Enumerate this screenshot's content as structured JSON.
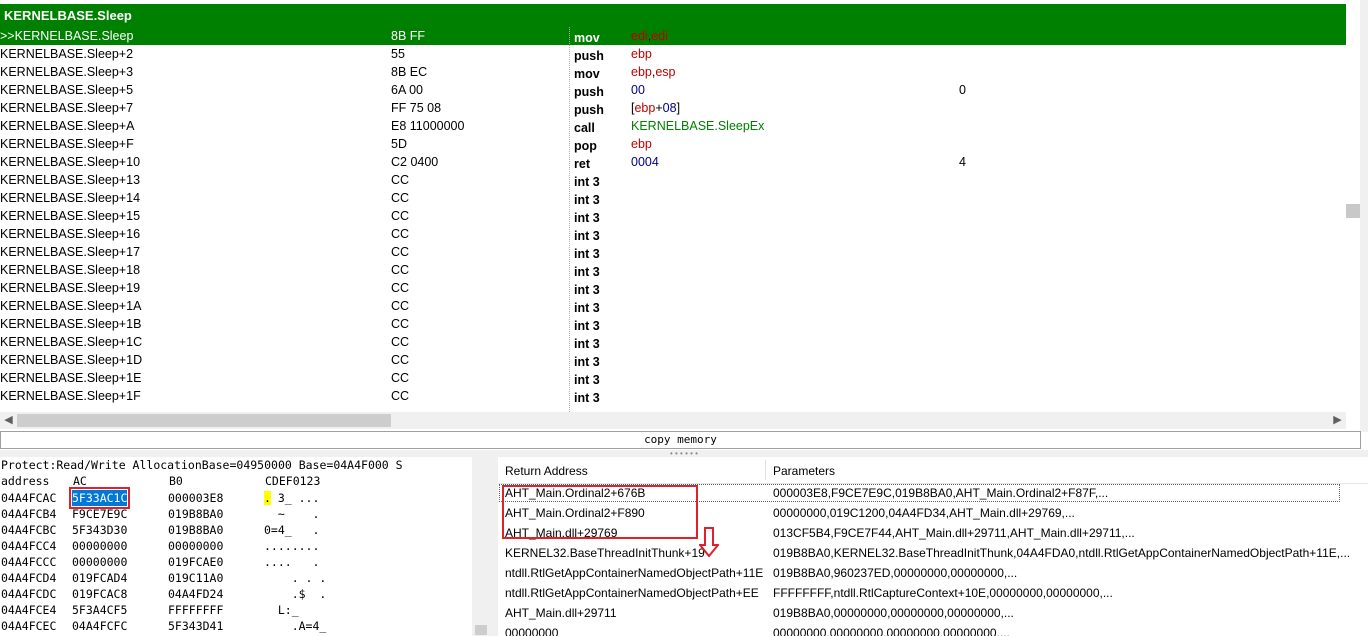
{
  "disasm": {
    "title": "KERNELBASE.Sleep",
    "rows": [
      {
        "addr": ">>KERNELBASE.Sleep",
        "bytes": "8B FF",
        "mn": "mov",
        "ops": [
          {
            "t": "edi",
            "c": "reg"
          },
          {
            "t": ",",
            "c": "plain"
          },
          {
            "t": "edi",
            "c": "reg"
          }
        ],
        "cm": "",
        "current": true
      },
      {
        "addr": "KERNELBASE.Sleep+2",
        "bytes": "55",
        "mn": "push",
        "ops": [
          {
            "t": "ebp",
            "c": "reg"
          }
        ],
        "cm": ""
      },
      {
        "addr": "KERNELBASE.Sleep+3",
        "bytes": "8B EC",
        "mn": "mov",
        "ops": [
          {
            "t": "ebp",
            "c": "reg"
          },
          {
            "t": ",",
            "c": "plain"
          },
          {
            "t": "esp",
            "c": "reg"
          }
        ],
        "cm": ""
      },
      {
        "addr": "KERNELBASE.Sleep+5",
        "bytes": "6A 00",
        "mn": "push",
        "ops": [
          {
            "t": "00",
            "c": "num"
          }
        ],
        "cm": "0"
      },
      {
        "addr": "KERNELBASE.Sleep+7",
        "bytes": "FF 75 08",
        "mn": "push",
        "ops": [
          {
            "t": "[",
            "c": "plain"
          },
          {
            "t": "ebp",
            "c": "reg"
          },
          {
            "t": "+",
            "c": "plain"
          },
          {
            "t": "08",
            "c": "num"
          },
          {
            "t": "]",
            "c": "plain"
          }
        ],
        "cm": ""
      },
      {
        "addr": "KERNELBASE.Sleep+A",
        "bytes": "E8 11000000",
        "mn": "call",
        "ops": [
          {
            "t": "KERNELBASE.SleepEx",
            "c": "call"
          }
        ],
        "cm": ""
      },
      {
        "addr": "KERNELBASE.Sleep+F",
        "bytes": "5D",
        "mn": "pop",
        "ops": [
          {
            "t": "ebp",
            "c": "reg"
          }
        ],
        "cm": ""
      },
      {
        "addr": "KERNELBASE.Sleep+10",
        "bytes": "C2 0400",
        "mn": "ret",
        "ops": [
          {
            "t": "0004",
            "c": "num"
          }
        ],
        "cm": "4"
      },
      {
        "addr": "KERNELBASE.Sleep+13",
        "bytes": "CC",
        "mn": "int 3",
        "ops": [],
        "cm": ""
      },
      {
        "addr": "KERNELBASE.Sleep+14",
        "bytes": "CC",
        "mn": "int 3",
        "ops": [],
        "cm": ""
      },
      {
        "addr": "KERNELBASE.Sleep+15",
        "bytes": "CC",
        "mn": "int 3",
        "ops": [],
        "cm": ""
      },
      {
        "addr": "KERNELBASE.Sleep+16",
        "bytes": "CC",
        "mn": "int 3",
        "ops": [],
        "cm": ""
      },
      {
        "addr": "KERNELBASE.Sleep+17",
        "bytes": "CC",
        "mn": "int 3",
        "ops": [],
        "cm": ""
      },
      {
        "addr": "KERNELBASE.Sleep+18",
        "bytes": "CC",
        "mn": "int 3",
        "ops": [],
        "cm": ""
      },
      {
        "addr": "KERNELBASE.Sleep+19",
        "bytes": "CC",
        "mn": "int 3",
        "ops": [],
        "cm": ""
      },
      {
        "addr": "KERNELBASE.Sleep+1A",
        "bytes": "CC",
        "mn": "int 3",
        "ops": [],
        "cm": ""
      },
      {
        "addr": "KERNELBASE.Sleep+1B",
        "bytes": "CC",
        "mn": "int 3",
        "ops": [],
        "cm": ""
      },
      {
        "addr": "KERNELBASE.Sleep+1C",
        "bytes": "CC",
        "mn": "int 3",
        "ops": [],
        "cm": ""
      },
      {
        "addr": "KERNELBASE.Sleep+1D",
        "bytes": "CC",
        "mn": "int 3",
        "ops": [],
        "cm": ""
      },
      {
        "addr": "KERNELBASE.Sleep+1E",
        "bytes": "CC",
        "mn": "int 3",
        "ops": [],
        "cm": ""
      },
      {
        "addr": "KERNELBASE.Sleep+1F",
        "bytes": "CC",
        "mn": "int 3",
        "ops": [],
        "cm": ""
      }
    ]
  },
  "copybar": {
    "label": "copy memory"
  },
  "dump": {
    "info": "Protect:Read/Write  AllocationBase=04950000 Base=04A4F000 S",
    "cols": {
      "address": "address",
      "c1": "AC",
      "c2": "B0",
      "c3": "CDEF0123"
    },
    "rows": [
      {
        "addr": "04A4FCAC",
        "v1": "5F33AC1C",
        "v2": "000003E8",
        "asc_hl": ".",
        "asc": " 3_ ...",
        "selected": true
      },
      {
        "addr": "04A4FCB4",
        "v1": "F9CE7E9C",
        "v2": "019B8BA0",
        "asc": "  ~    ."
      },
      {
        "addr": "04A4FCBC",
        "v1": "5F343D30",
        "v2": "019B8BA0",
        "asc": "0=4_   ."
      },
      {
        "addr": "04A4FCC4",
        "v1": "00000000",
        "v2": "00000000",
        "asc": "........"
      },
      {
        "addr": "04A4FCCC",
        "v1": "00000000",
        "v2": "019FCAE0",
        "asc": "....   ."
      },
      {
        "addr": "04A4FCD4",
        "v1": "019FCAD4",
        "v2": "019C11A0",
        "asc": "    . . ."
      },
      {
        "addr": "04A4FCDC",
        "v1": "019FCAC8",
        "v2": "04A4FD24",
        "asc": "    .$  ."
      },
      {
        "addr": "04A4FCE4",
        "v1": "5F3A4CF5",
        "v2": "FFFFFFFF",
        "asc": "  L:_"
      },
      {
        "addr": "04A4FCEC",
        "v1": "04A4FCFC",
        "v2": "5F343D41",
        "asc": "    .A=4_"
      }
    ]
  },
  "stack": {
    "headers": {
      "ret": "Return Address",
      "par": "Parameters"
    },
    "rows": [
      {
        "ret": "AHT_Main.Ordinal2+676B",
        "par": "000003E8,F9CE7E9C,019B8BA0,AHT_Main.Ordinal2+F87F,...",
        "focus": true
      },
      {
        "ret": "AHT_Main.Ordinal2+F890",
        "par": "00000000,019C1200,04A4FD34,AHT_Main.dll+29769,..."
      },
      {
        "ret": "AHT_Main.dll+29769",
        "par": "013CF5B4,F9CE7F44,AHT_Main.dll+29711,AHT_Main.dll+29711,..."
      },
      {
        "ret": "KERNEL32.BaseThreadInitThunk+19",
        "par": "019B8BA0,KERNEL32.BaseThreadInitThunk,04A4FDA0,ntdll.RtlGetAppContainerNamedObjectPath+11E,..."
      },
      {
        "ret": "ntdll.RtlGetAppContainerNamedObjectPath+11E",
        "par": "019B8BA0,960237ED,00000000,00000000,..."
      },
      {
        "ret": "ntdll.RtlGetAppContainerNamedObjectPath+EE",
        "par": "FFFFFFFF,ntdll.RtlCaptureContext+10E,00000000,00000000,..."
      },
      {
        "ret": "AHT_Main.dll+29711",
        "par": "019B8BA0,00000000,00000000,00000000,..."
      },
      {
        "ret": "00000000",
        "par": "00000000,00000000,00000000,00000000,..."
      }
    ]
  },
  "icons": {
    "left_arrow": "chevron-left-icon",
    "right_arrow": "chevron-right-icon",
    "down_arrow": "outline-down-arrow-icon"
  },
  "colors": {
    "header_green": "#008000",
    "highlight_red": "#e0202a",
    "selection_blue": "#0078d7"
  }
}
